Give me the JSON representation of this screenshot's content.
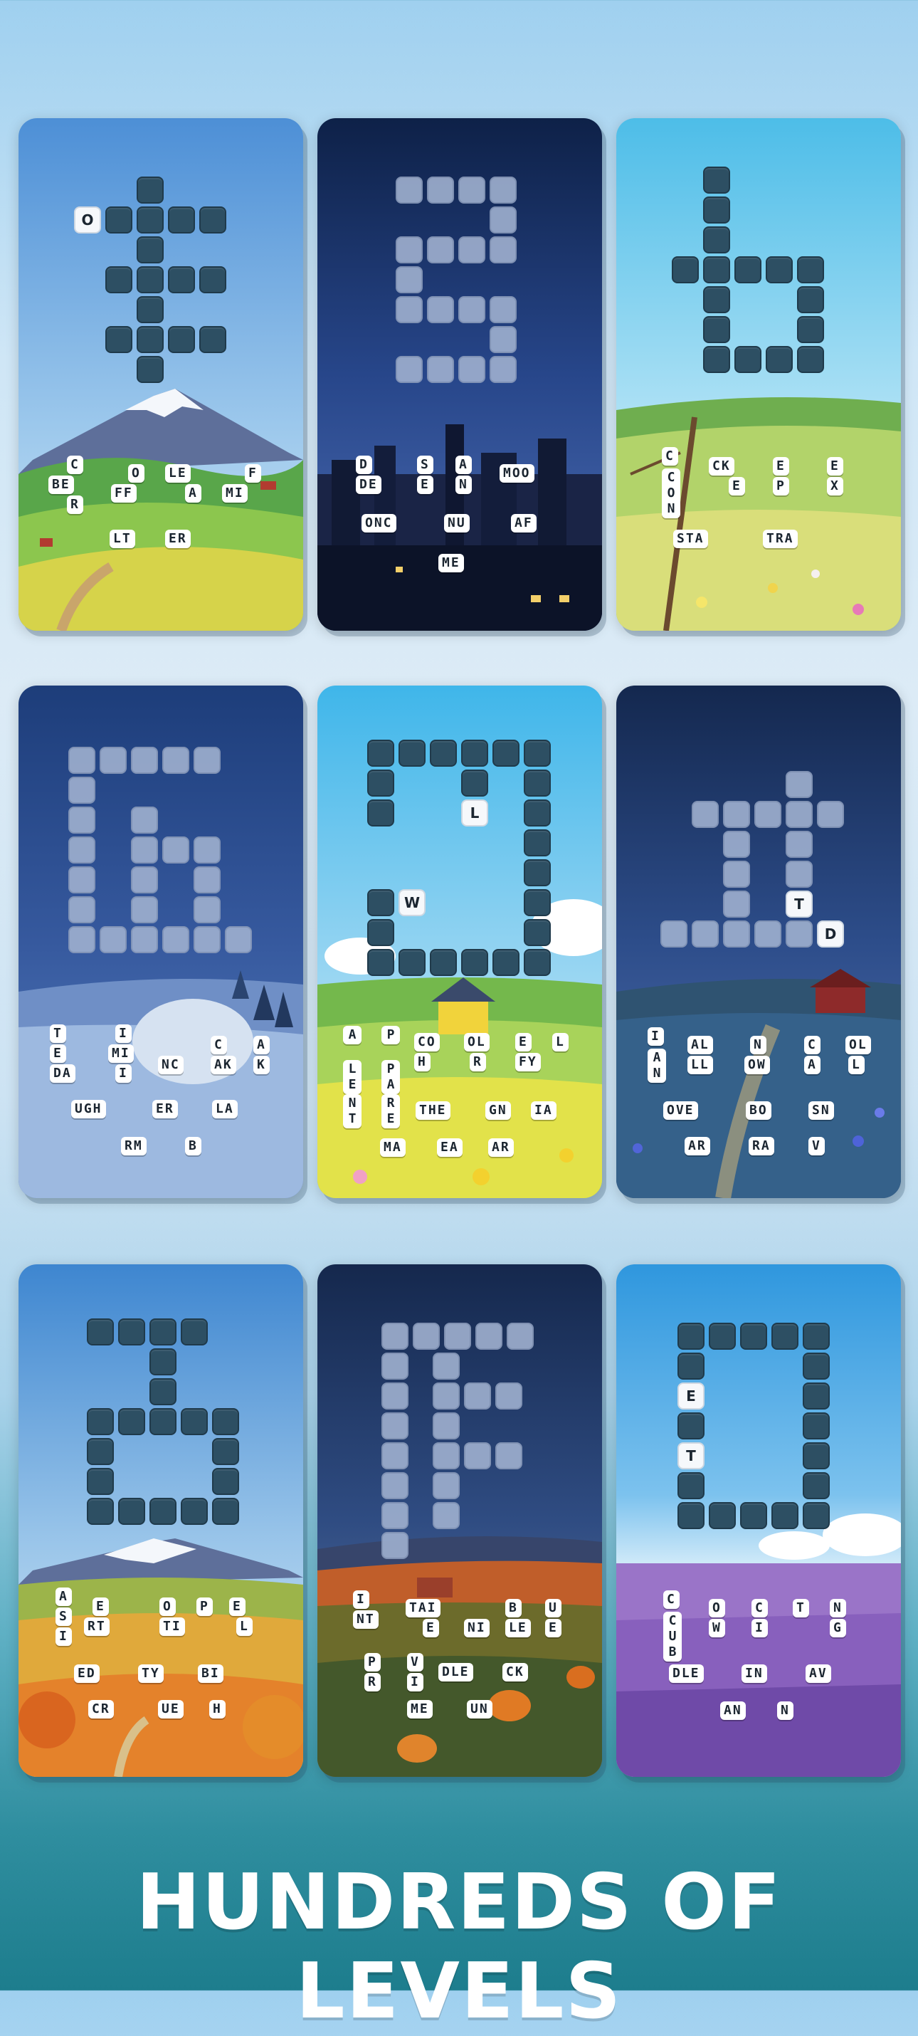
{
  "footer": {
    "title": "HUNDREDS OF LEVELS"
  },
  "colors": {
    "tile_dark": "#2d4f63",
    "tile_light": "#9fb0cf",
    "tile_letter_bg": "#f6f8fb"
  },
  "levels": [
    {
      "name": "mountain-meadow",
      "revealed_letter": "O",
      "word_chips": [
        "C",
        "BE",
        "R",
        "O",
        "FF",
        "LE",
        "A",
        "F",
        "MI",
        "LT",
        "ER"
      ]
    },
    {
      "name": "night-city",
      "word_chips": [
        "D",
        "DE",
        "S",
        "E",
        "A",
        "N",
        "MOO",
        "ONC",
        "NU",
        "AF",
        "ME"
      ]
    },
    {
      "name": "fence-meadow",
      "word_chips": [
        "C",
        "CON",
        "CK",
        "E",
        "E",
        "P",
        "E",
        "X",
        "STA",
        "TRA"
      ]
    },
    {
      "name": "igloo-snow",
      "word_chips": [
        "T",
        "E",
        "DA",
        "I",
        "MI",
        "I",
        "NC",
        "C",
        "AK",
        "A",
        "K",
        "UGH",
        "ER",
        "LA",
        "RM",
        "B"
      ]
    },
    {
      "name": "yellow-house",
      "revealed_letters": [
        "L",
        "W"
      ],
      "word_chips": [
        "A",
        "LE",
        "NT",
        "P",
        "PA",
        "RE",
        "CO",
        "H",
        "OL",
        "R",
        "E",
        "FY",
        "L",
        "THE",
        "GN",
        "IA",
        "MA",
        "EA",
        "AR"
      ]
    },
    {
      "name": "barn-night",
      "revealed_letters": [
        "T",
        "D"
      ],
      "word_chips": [
        "I",
        "AN",
        "AL",
        "LL",
        "N",
        "OW",
        "C",
        "A",
        "OL",
        "L",
        "OVE",
        "BO",
        "SN",
        "AR",
        "RA",
        "V"
      ]
    },
    {
      "name": "autumn-mountain",
      "word_chips": [
        "A",
        "S",
        "I",
        "E",
        "RT",
        "O",
        "TI",
        "P",
        "E",
        "L",
        "ED",
        "TY",
        "BI",
        "CR",
        "UE",
        "H"
      ]
    },
    {
      "name": "pumpkin-field",
      "word_chips": [
        "I",
        "NT",
        "TAI",
        "E",
        "NI",
        "B",
        "LE",
        "U",
        "E",
        "P",
        "R",
        "V",
        "I",
        "DLE",
        "CK",
        "ME",
        "UN"
      ]
    },
    {
      "name": "lavender-field",
      "revealed_letters": [
        "E",
        "T"
      ],
      "word_chips": [
        "C",
        "CUB",
        "O",
        "W",
        "C",
        "I",
        "T",
        "N",
        "G",
        "DLE",
        "IN",
        "AV",
        "AN",
        "N"
      ]
    }
  ]
}
